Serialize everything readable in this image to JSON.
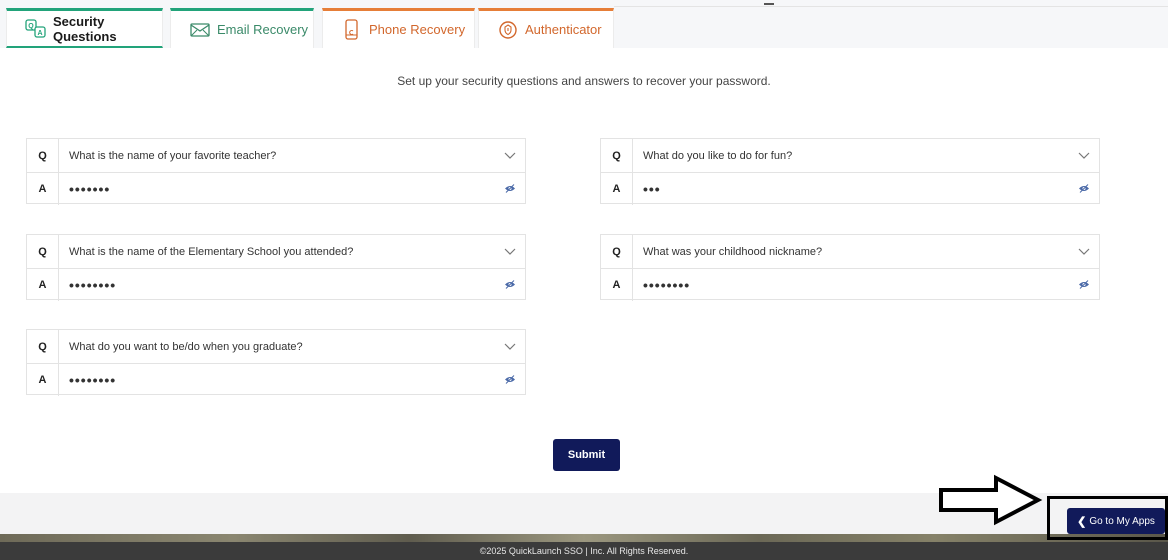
{
  "tabs": [
    {
      "label": "Security Questions",
      "icon": "qa-icon",
      "active": true,
      "accent": "#22a37a"
    },
    {
      "label": "Email Recovery",
      "icon": "envelope-icon",
      "accent": "#22a37a"
    },
    {
      "label": "Phone Recovery",
      "icon": "phone-icon",
      "accent": "#e67e38"
    },
    {
      "label": "Authenticator",
      "icon": "shield-icon",
      "accent": "#e67e38"
    }
  ],
  "intro": "Set up your security questions and answers to recover your password.",
  "qa_tag_q": "Q",
  "qa_tag_a": "A",
  "questions": [
    {
      "question": "What is the name of your favorite teacher?",
      "answer_mask": "•••••••"
    },
    {
      "question": "What do you like to do for fun?",
      "answer_mask": "•••"
    },
    {
      "question": "What is the name of the Elementary School you attended?",
      "answer_mask": "••••••••"
    },
    {
      "question": "What was your childhood nickname?",
      "answer_mask": "••••••••"
    },
    {
      "question": "What do you want to be/do when you graduate?",
      "answer_mask": "••••••••"
    }
  ],
  "submit_label": "Submit",
  "goto_label": "Go to My Apps",
  "footer_text": "©2025 QuickLaunch SSO | Inc. All Rights Reserved.",
  "colors": {
    "primary_button": "#111a5a",
    "green_accent": "#22a37a",
    "orange_accent": "#e67e38",
    "footer_bg": "#3b3b3b"
  }
}
